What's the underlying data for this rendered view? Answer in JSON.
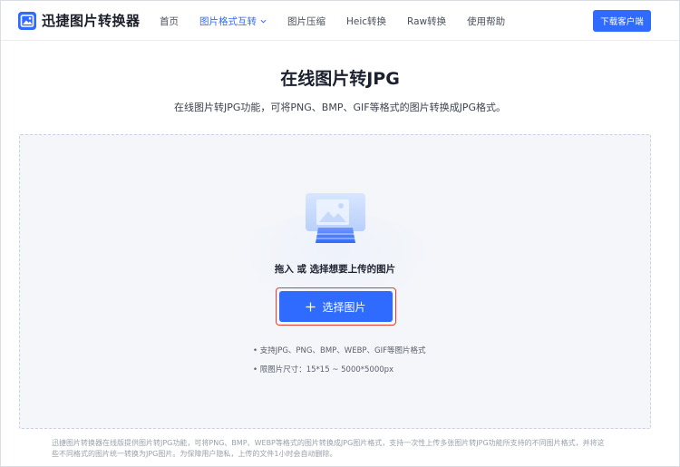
{
  "brand": {
    "name": "迅捷图片转换器",
    "accent": "#2f6bff"
  },
  "nav": {
    "items": [
      {
        "label": "首页"
      },
      {
        "label": "图片格式互转"
      },
      {
        "label": "图片压缩"
      },
      {
        "label": "Heic转换"
      },
      {
        "label": "Raw转换"
      },
      {
        "label": "使用帮助"
      }
    ],
    "active_index": 1,
    "download_label": "下载客户端"
  },
  "hero": {
    "title": "在线图片转JPG",
    "description": "在线图片转JPG功能，可将PNG、BMP、GIF等格式的图片转换成JPG格式。"
  },
  "upload": {
    "hint": "拖入 或 选择想要上传的图片",
    "button_label": "选择图片",
    "notes": [
      "• 支持JPG、PNG、BMP、WEBP、GIF等图片格式",
      "• 限图片尺寸：15*15 ~ 5000*5000px"
    ],
    "highlight_color": "#e0402f",
    "illustration_icon": "image-placeholder-icon"
  },
  "footer": {
    "line1": "迅捷图片转换器在线版提供图片转JPG功能，可将PNG、BMP、WEBP等格式的图片转换成JPG图片格式，支持一次性上传多张图片转JPG功能所支持的不同图片格式，并将这",
    "line2": "些不同格式的图片统一转换为JPG图片。为保障用户隐私，上传的文件1小时会自动删除。"
  }
}
